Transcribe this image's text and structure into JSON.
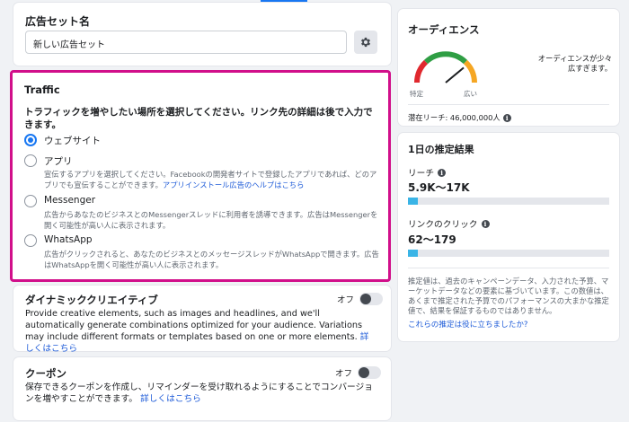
{
  "adset": {
    "title": "広告セット名",
    "name_value": "新しい広告セット"
  },
  "traffic": {
    "heading": "Traffic",
    "description": "トラフィックを増やしたい場所を選択してください。リンク先の詳細は後で入力できます。",
    "options": [
      {
        "label": "ウェブサイト",
        "selected": true,
        "sub": "",
        "link": ""
      },
      {
        "label": "アプリ",
        "selected": false,
        "sub": "宣伝するアプリを選択してください。Facebookの開発者サイトで登録したアプリであれば、どのアプリでも宣伝することができます。",
        "link": "アプリインストール広告のヘルプはこちら"
      },
      {
        "label": "Messenger",
        "selected": false,
        "sub": "広告からあなたのビジネスとのMessengerスレッドに利用者を誘導できます。広告はMessengerを開く可能性が高い人に表示されます。",
        "link": ""
      },
      {
        "label": "WhatsApp",
        "selected": false,
        "sub": "広告がクリックされると、あなたのビジネスとのメッセージスレッドがWhatsAppで開きます。広告はWhatsAppを開く可能性が高い人に表示されます。",
        "link": ""
      }
    ]
  },
  "dynamic_creative": {
    "heading": "ダイナミッククリエイティブ",
    "toggle_label": "オフ",
    "toggle_on": false,
    "body": "Provide creative elements, such as images and headlines, and we'll automatically generate combinations optimized for your audience. Variations may include different formats or templates based on one or more elements.",
    "link": "詳しくはこちら"
  },
  "coupon": {
    "heading": "クーポン",
    "toggle_label": "オフ",
    "toggle_on": false,
    "body": "保存できるクーポンを作成し、リマインダーを受け取れるようにすることでコンバージョンを増やすことができます。",
    "link": "詳しくはこちら"
  },
  "audience": {
    "heading": "オーディエンス",
    "gauge_left": "特定",
    "gauge_right": "広い",
    "gauge_level": 0.78,
    "note": "オーディエンスが少々広すぎます。",
    "potential_reach": "潜在リーチ: 46,000,000人"
  },
  "estimates": {
    "heading": "1日の推定結果",
    "reach_label": "リーチ",
    "reach_value": "5.9K〜17K",
    "reach_fill": 0.05,
    "clicks_label": "リンクのクリック",
    "clicks_value": "62〜179",
    "clicks_fill": 0.05,
    "disclaimer": "推定値は、過去のキャンペーンデータ、入力された予算、マーケットデータなどの要素に基づいています。この数値は、あくまで推定された予算でのパフォーマンスの大まかな推定値で、結果を保証するものではありません。",
    "help_link": "これらの推定は役に立ちましたか?"
  },
  "colors": {
    "accent": "#1877f2",
    "highlight_border": "#d10f8a",
    "bar_fill": "#3ab4e6"
  },
  "icons": {
    "settings": "gear-icon",
    "info": "info-icon"
  }
}
